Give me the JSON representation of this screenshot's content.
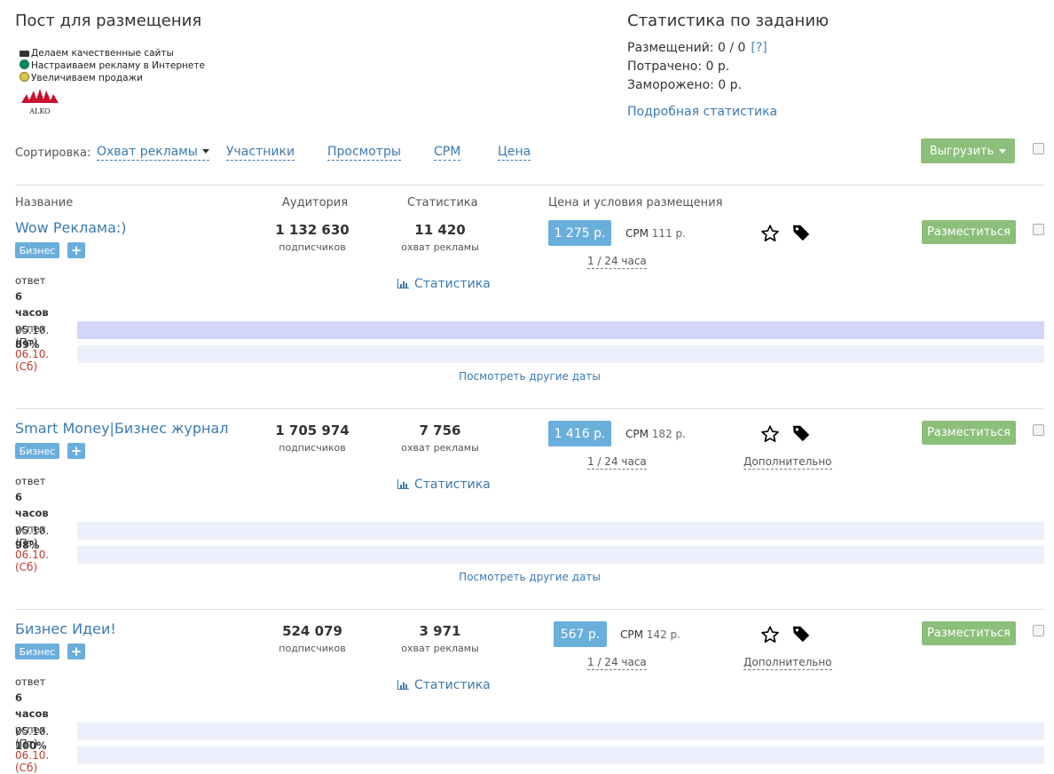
{
  "post": {
    "title": "Пост для размещения",
    "lines": [
      {
        "icon": "laptop-icon",
        "text": "Делаем качественные сайты"
      },
      {
        "icon": "globe-icon",
        "text": "Настраиваем рекламу в Интернете"
      },
      {
        "icon": "coin-icon",
        "text": "Увеличиваем продажи"
      }
    ],
    "logo_text": "ALKO"
  },
  "task_stats": {
    "title": "Статистика по заданию",
    "placements": "Размещений: 0 / 0",
    "help": "[?]",
    "spent": "Потрачено: 0 р.",
    "frozen": "Заморожено: 0 р.",
    "details_link": "Подробная статистика"
  },
  "sort": {
    "label": "Сортировка:",
    "items": [
      "Охват рекламы",
      "Участники",
      "Просмотры",
      "CPM",
      "Цена"
    ]
  },
  "export_label": "Выгрузить",
  "columns": {
    "name": "Название",
    "audience": "Аудитория",
    "stats": "Статистика",
    "price": "Цена и условия размещения"
  },
  "channels": [
    {
      "name": "Wow Реклама:)",
      "tag": "Бизнес",
      "plus": "+",
      "reply_label": "ответ",
      "reply_value": "6 часов",
      "success_label": "успех",
      "success_value": "89%",
      "audience": "1 132 630",
      "audience_sub": "подписчиков",
      "reach": "11 420",
      "reach_sub": "охват рекламы",
      "stats_link": "Статистика",
      "price": "1 275 р.",
      "cpm_label": "CPM",
      "cpm_value": "111 р.",
      "terms": "1 / 24 часа",
      "extra": "",
      "place_label": "Разместиться",
      "dates": [
        {
          "label": "05.10. (Пт)",
          "weekend": false
        },
        {
          "label": "06.10. (Сб)",
          "weekend": true
        }
      ],
      "more_dates": "Посмотреть другие даты"
    },
    {
      "name": "Smart Money|Бизнес журнал",
      "tag": "Бизнес",
      "plus": "+",
      "reply_label": "ответ",
      "reply_value": "6 часов",
      "success_label": "успех",
      "success_value": "98%",
      "audience": "1 705 974",
      "audience_sub": "подписчиков",
      "reach": "7 756",
      "reach_sub": "охват рекламы",
      "stats_link": "Статистика",
      "price": "1 416 р.",
      "cpm_label": "CPM",
      "cpm_value": "182 р.",
      "terms": "1 / 24 часа",
      "extra": "Дополнительно",
      "place_label": "Разместиться",
      "dates": [
        {
          "label": "05.10. (Пт)",
          "weekend": false
        },
        {
          "label": "06.10. (Сб)",
          "weekend": true
        }
      ],
      "more_dates": "Посмотреть другие даты"
    },
    {
      "name": "Бизнес Идеи!",
      "tag": "Бизнес",
      "plus": "+",
      "reply_label": "ответ",
      "reply_value": "6 часов",
      "success_label": "успех",
      "success_value": "100%",
      "audience": "524 079",
      "audience_sub": "подписчиков",
      "reach": "3 971",
      "reach_sub": "охват рекламы",
      "stats_link": "Статистика",
      "price": "567 р.",
      "cpm_label": "CPM",
      "cpm_value": "142 р.",
      "terms": "1 / 24 часа",
      "extra": "Дополнительно",
      "place_label": "Разместиться",
      "dates": [
        {
          "label": "05.10. (Пт)",
          "weekend": false
        },
        {
          "label": "06.10. (Сб)",
          "weekend": true
        }
      ],
      "more_dates": ""
    }
  ],
  "colors": {
    "link": "#3a7ab0",
    "accent_blue": "#6aaedc",
    "button_green": "#8cbf7a",
    "date_bar_dark": "#d3d5fb",
    "date_bar_light": "#eeeffd",
    "weekend_red": "#c0392b"
  }
}
